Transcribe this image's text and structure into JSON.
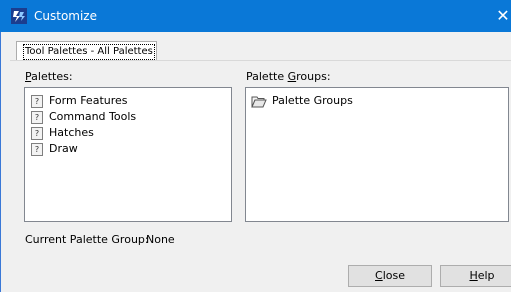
{
  "window": {
    "title": "Customize",
    "accent": "#0a78d7"
  },
  "tab": {
    "label": "Tool Palettes - All Palettes"
  },
  "palettes": {
    "label_accel": "P",
    "label_rest": "alettes:",
    "items": [
      {
        "label": "Form Features",
        "icon": "unknown-palette-icon"
      },
      {
        "label": "Command Tools",
        "icon": "unknown-palette-icon"
      },
      {
        "label": "Hatches",
        "icon": "unknown-palette-icon"
      },
      {
        "label": "Draw",
        "icon": "unknown-palette-icon"
      }
    ]
  },
  "palette_groups": {
    "label_pre": "Palette ",
    "label_accel": "G",
    "label_rest": "roups:",
    "items": [
      {
        "label": "Palette Groups",
        "icon": "folder-open-icon"
      }
    ]
  },
  "current_group": {
    "label": "Current Palette Group:",
    "value": "None"
  },
  "buttons": {
    "close": {
      "accel": "C",
      "rest": "lose"
    },
    "help": {
      "accel": "H",
      "rest": "elp"
    }
  }
}
